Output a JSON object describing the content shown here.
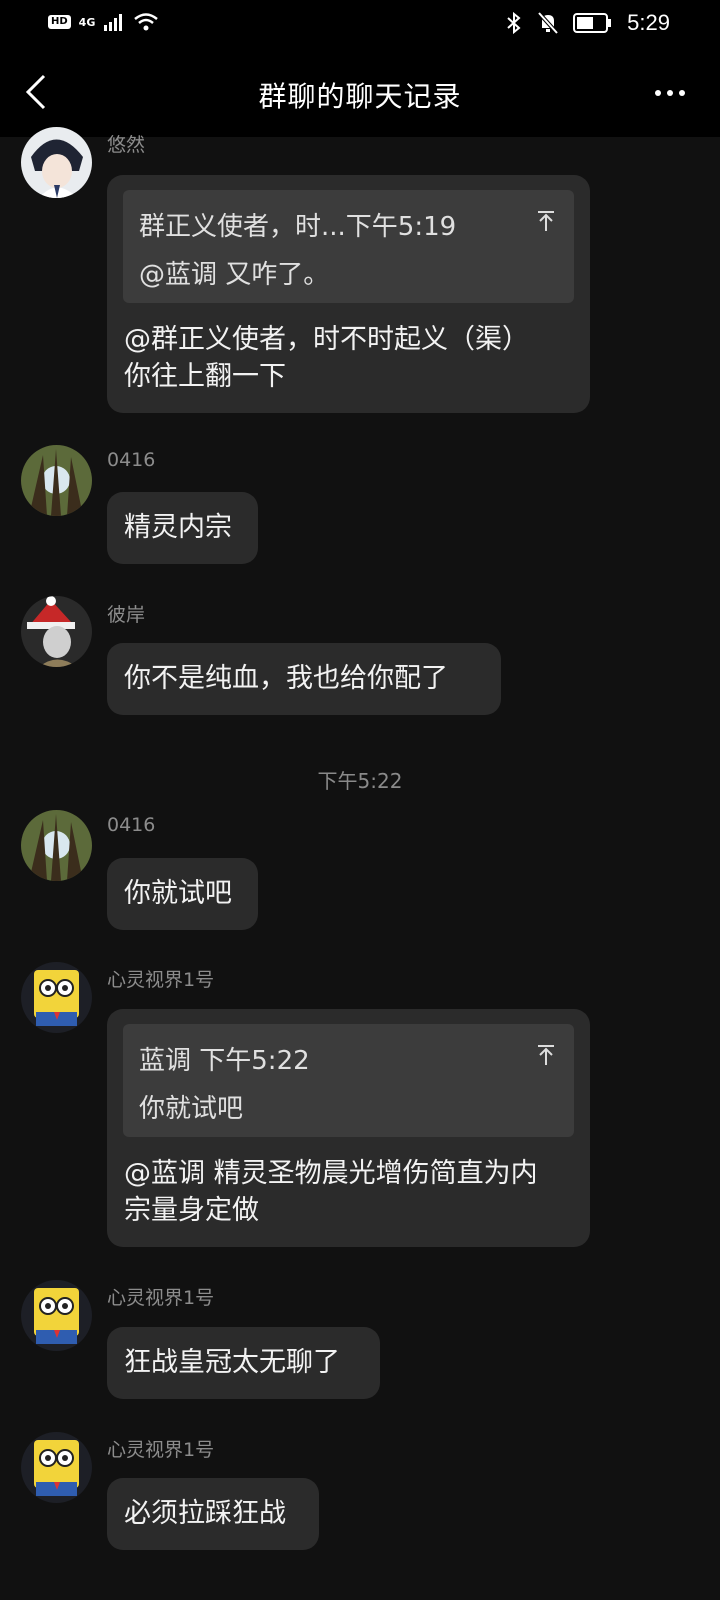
{
  "status_bar": {
    "hd": "HD",
    "network": "4G",
    "time": "5:29",
    "icons": [
      "hd-icon",
      "signal-icon",
      "wifi-icon",
      "bluetooth-icon",
      "mute-icon",
      "battery-icon"
    ]
  },
  "header": {
    "title": "群聊的聊天记录",
    "back_icon": "chevron-left-icon",
    "more_icon": "more-dots-icon"
  },
  "messages": [
    {
      "sender": "悠然",
      "quote": {
        "head": "群正义使者，时...下午5:19",
        "body": "@蓝调 又咋了。"
      },
      "text_lines": [
        "@群正义使者，时不时起义（渠）",
        "你往上翻一下"
      ]
    },
    {
      "sender": "0416",
      "text_lines": [
        "精灵内宗"
      ]
    },
    {
      "sender": "彼岸",
      "text_lines": [
        "你不是纯血，我也给你配了"
      ]
    },
    {
      "sender": "0416",
      "text_lines": [
        "你就试吧"
      ]
    },
    {
      "sender": "心灵视界1号",
      "quote": {
        "head": "蓝调 下午5:22",
        "body": "你就试吧"
      },
      "text_lines": [
        "@蓝调 精灵圣物晨光增伤简直为内",
        "宗量身定做"
      ]
    },
    {
      "sender": "心灵视界1号",
      "text_lines": [
        "狂战皇冠太无聊了"
      ]
    },
    {
      "sender": "心灵视界1号",
      "text_lines": [
        "必须拉踩狂战"
      ]
    }
  ],
  "time_divider": "下午5:22",
  "colors": {
    "background": "#111111",
    "bubble": "#2b2b2b",
    "quote": "#3c3c3c",
    "bar": "#000000"
  }
}
